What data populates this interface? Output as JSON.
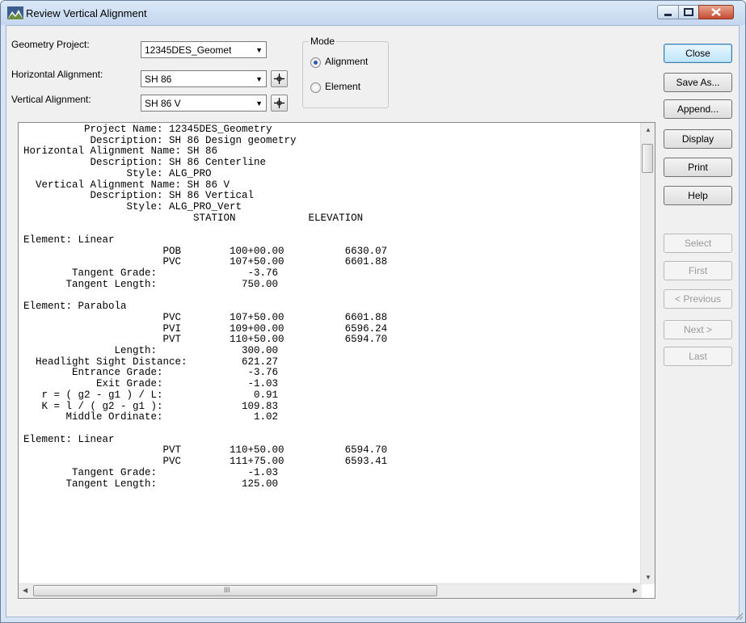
{
  "window": {
    "title": "Review Vertical Alignment"
  },
  "form": {
    "geometry_project_label": "Geometry Project:",
    "geometry_project_value": "12345DES_Geomet",
    "horizontal_alignment_label": "Horizontal Alignment:",
    "horizontal_alignment_value": "SH 86",
    "vertical_alignment_label": "Vertical Alignment:",
    "vertical_alignment_value": "SH 86 V"
  },
  "mode": {
    "title": "Mode",
    "options": [
      {
        "label": "Alignment",
        "selected": true
      },
      {
        "label": "Element",
        "selected": false
      }
    ]
  },
  "buttons": {
    "close": "Close",
    "save_as": "Save As...",
    "append": "Append...",
    "display": "Display",
    "print": "Print",
    "help": "Help",
    "select": "Select",
    "first": "First",
    "previous": "< Previous",
    "next": "Next >",
    "last": "Last"
  },
  "report_text": "          Project Name: 12345DES_Geometry\n           Description: SH 86 Design geometry\nHorizontal Alignment Name: SH 86\n           Description: SH 86 Centerline\n                 Style: ALG_PRO\n  Vertical Alignment Name: SH 86 V\n           Description: SH 86 Vertical\n                 Style: ALG_PRO_Vert\n                            STATION            ELEVATION\n\nElement: Linear\n                       POB        100+00.00          6630.07\n                       PVC        107+50.00          6601.88\n        Tangent Grade:               -3.76\n       Tangent Length:              750.00\n\nElement: Parabola\n                       PVC        107+50.00          6601.88\n                       PVI        109+00.00          6596.24\n                       PVT        110+50.00          6594.70\n               Length:              300.00\n  Headlight Sight Distance:         621.27\n        Entrance Grade:              -3.76\n            Exit Grade:              -1.03\n   r = ( g2 - g1 ) / L:               0.91\n   K = l / ( g2 - g1 ):             109.83\n       Middle Ordinate:               1.02\n\nElement: Linear\n                       PVT        110+50.00          6594.70\n                       PVC        111+75.00          6593.41\n        Tangent Grade:               -1.03\n       Tangent Length:              125.00",
  "scrollbars": {
    "hscroll_grip": "III"
  }
}
